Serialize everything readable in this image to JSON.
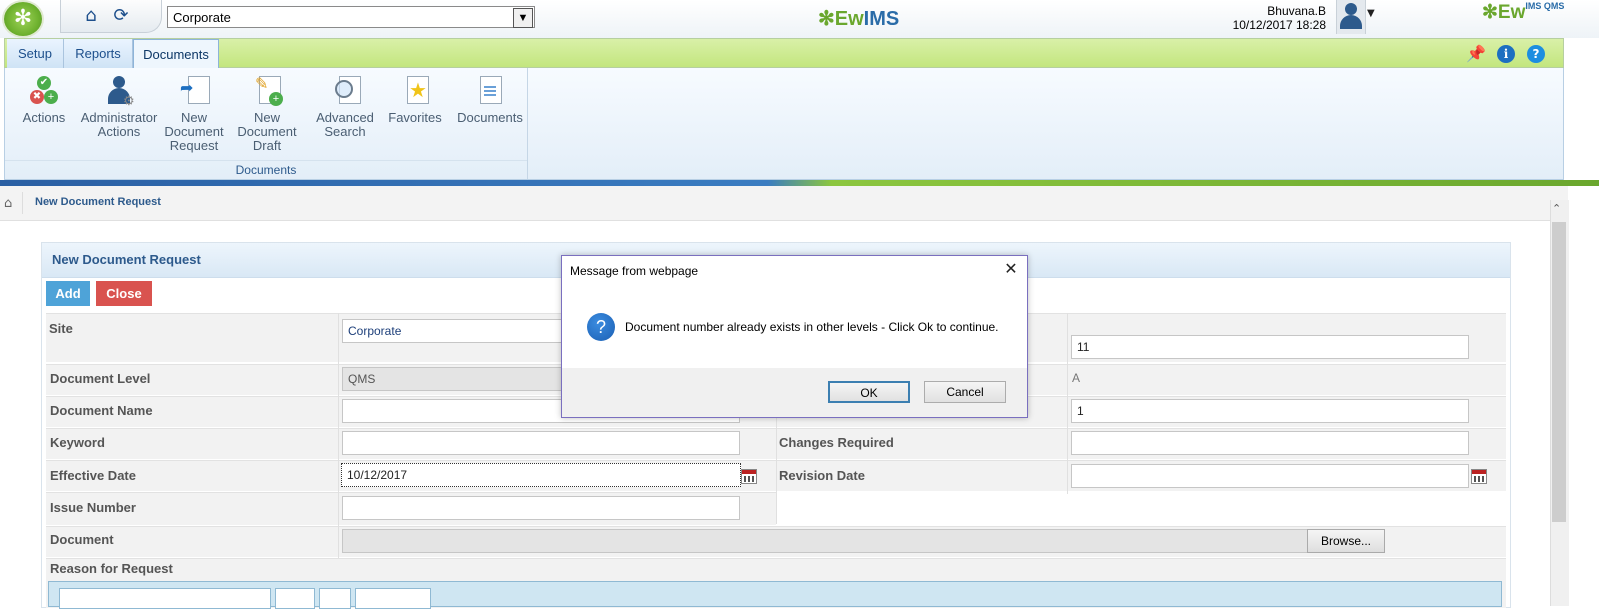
{
  "header": {
    "site_select_value": "Corporate",
    "brand_center_a": "Ew",
    "brand_center_b": "IMS",
    "brand_right_a": "Ew",
    "brand_right_small": "IMS QMS",
    "user_name": "Bhuvana.B",
    "datetime": "10/12/2017 18:28"
  },
  "ribbon": {
    "tabs": [
      {
        "label": "Setup"
      },
      {
        "label": "Reports"
      },
      {
        "label": "Documents"
      }
    ],
    "buttons": [
      {
        "label": "Actions",
        "icon": "actions-icon"
      },
      {
        "label": "Administrator Actions",
        "icon": "admin-user-gear-icon"
      },
      {
        "label": "New Document Request",
        "icon": "new-document-request-icon"
      },
      {
        "label": "New Document Draft",
        "icon": "new-document-draft-icon"
      },
      {
        "label": "Advanced Search",
        "icon": "magnifier-icon"
      },
      {
        "label": "Favorites",
        "icon": "star-icon"
      },
      {
        "label": "Documents",
        "icon": "documents-icon"
      }
    ],
    "group_label": "Documents"
  },
  "breadcrumb": {
    "current": "New Document Request"
  },
  "form": {
    "title": "New Document Request",
    "add_label": "Add",
    "close_label": "Close",
    "site_label": "Site",
    "site_value": "Corporate",
    "document_level_label": "Document Level",
    "document_level_value": "QMS",
    "document_name_label": "Document Name",
    "keyword_label": "Keyword",
    "effective_date_label": "Effective Date",
    "effective_date_value": "10/12/2017",
    "issue_number_label": "Issue Number",
    "document_label": "Document",
    "browse_label": "Browse...",
    "reason_label": "Reason for Request",
    "changes_required_label": "Changes Required",
    "revision_date_label": "Revision Date",
    "right_field_1_value": "11",
    "right_field_2_value": "A",
    "right_field_3_value": "1"
  },
  "dialog": {
    "title": "Message from webpage",
    "message": "Document number already exists in other levels - Click Ok to continue.",
    "ok_label": "OK",
    "cancel_label": "Cancel",
    "icon": "question-icon"
  },
  "colors": {
    "tab_bar_green": "#c3e67e",
    "accent_blue": "#2d5a8c",
    "add_button": "#4ea3d8",
    "close_button": "#d9534f"
  }
}
